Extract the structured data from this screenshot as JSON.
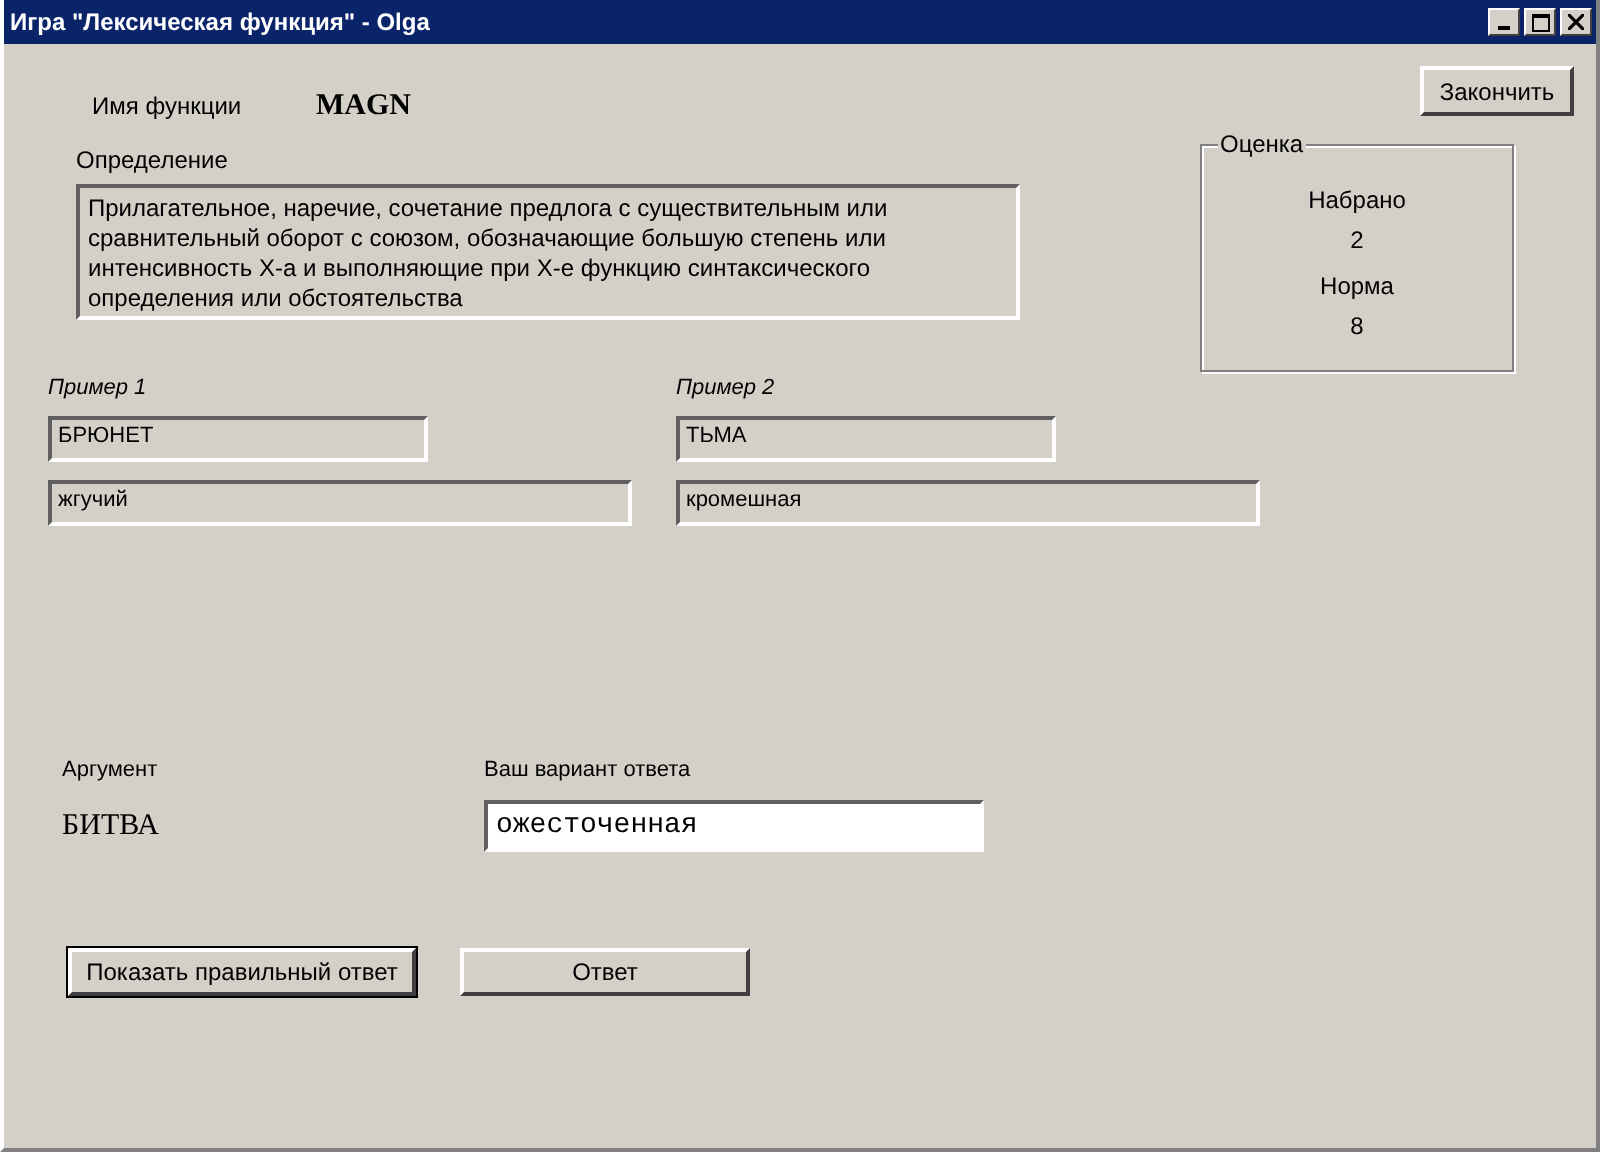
{
  "window": {
    "title": "Игра \"Лексическая функция\" - Olga"
  },
  "function_name": {
    "label": "Имя функции",
    "value": "MAGN"
  },
  "definition": {
    "label": "Определение",
    "text": "Прилагательное, наречие, сочетание предлога с существительным или сравнительный оборот с союзом, обозначающие большую степень или интенсивность X-а и выполняющие при X-е функцию синтаксического определения или обстоятельства"
  },
  "finish_button": "Закончить",
  "score": {
    "title": "Оценка",
    "items": [
      {
        "label": "Набрано",
        "value": "2"
      },
      {
        "label": "Норма",
        "value": "8"
      }
    ]
  },
  "examples": [
    {
      "label": "Пример 1",
      "argument": "БРЮНЕТ",
      "value": "жгучий"
    },
    {
      "label": "Пример 2",
      "argument": "ТЬМА",
      "value": "кромешная"
    }
  ],
  "argument": {
    "label": "Аргумент",
    "value": "БИТВА"
  },
  "answer": {
    "label": "Ваш вариант ответа",
    "value": "ожесточенная"
  },
  "buttons": [
    {
      "label": "Показать правильный ответ",
      "default": true
    },
    {
      "label": "Ответ",
      "default": false
    }
  ]
}
